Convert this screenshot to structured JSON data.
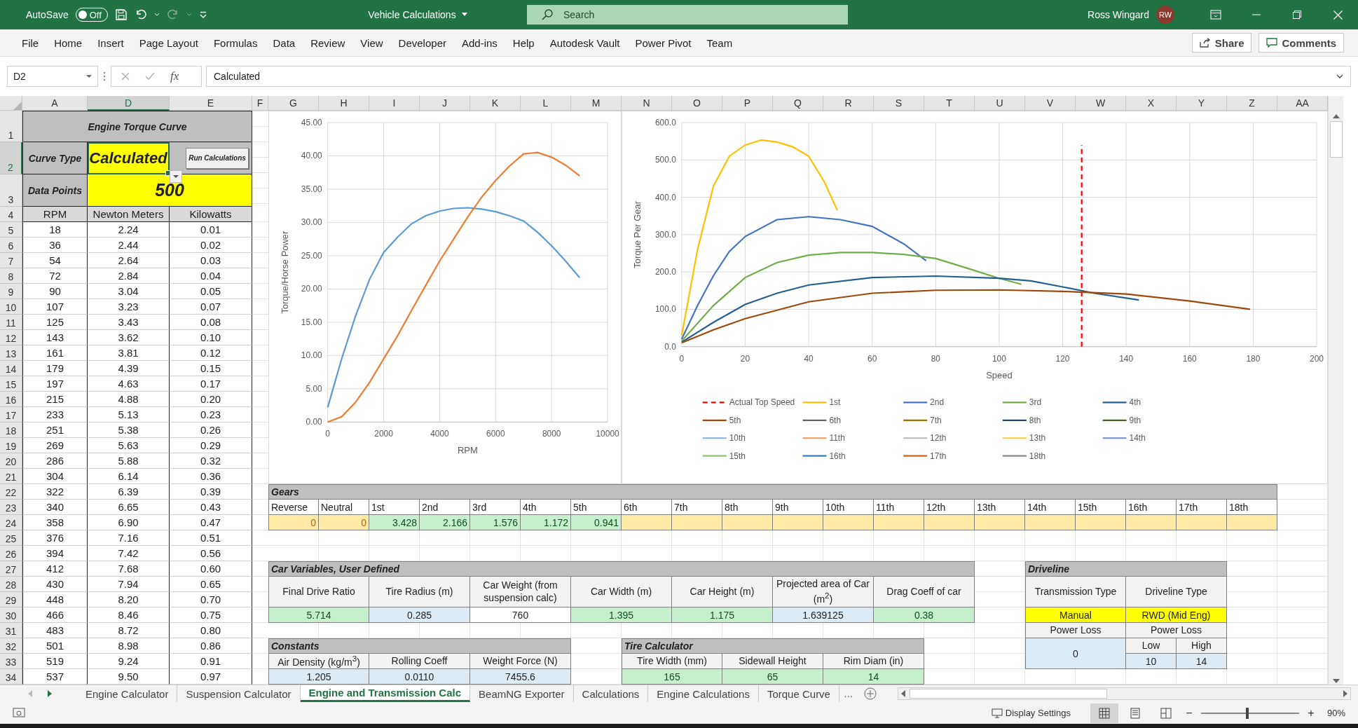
{
  "title_bar": {
    "autosave_label": "AutoSave",
    "autosave": {
      "on": false,
      "label": "Off"
    },
    "document_title": "Vehicle Calculations",
    "search_placeholder": "Search",
    "user_name": "Ross Wingard",
    "user_initials": "RW"
  },
  "ribbon_tabs": [
    "File",
    "Home",
    "Insert",
    "Page Layout",
    "Formulas",
    "Data",
    "Review",
    "View",
    "Developer",
    "Add-ins",
    "Help",
    "Autodesk Vault",
    "Power Pivot",
    "Team"
  ],
  "share_button": "Share",
  "comments_button": "Comments",
  "formula_bar": {
    "name_box": "D2",
    "fx": "fx",
    "value": "Calculated"
  },
  "column_headers": [
    {
      "label": "A",
      "selected": false
    },
    {
      "label": "D",
      "selected": true
    },
    {
      "label": "E",
      "selected": false
    },
    {
      "label": "F",
      "selected": false
    },
    {
      "label": "G",
      "selected": false
    },
    {
      "label": "H",
      "selected": false
    },
    {
      "label": "I",
      "selected": false
    },
    {
      "label": "J",
      "selected": false
    },
    {
      "label": "K",
      "selected": false
    },
    {
      "label": "L",
      "selected": false
    },
    {
      "label": "M",
      "selected": false
    },
    {
      "label": "N",
      "selected": false
    },
    {
      "label": "O",
      "selected": false
    },
    {
      "label": "P",
      "selected": false
    },
    {
      "label": "Q",
      "selected": false
    },
    {
      "label": "R",
      "selected": false
    },
    {
      "label": "S",
      "selected": false
    },
    {
      "label": "T",
      "selected": false
    },
    {
      "label": "U",
      "selected": false
    },
    {
      "label": "V",
      "selected": false
    },
    {
      "label": "W",
      "selected": false
    },
    {
      "label": "X",
      "selected": false
    },
    {
      "label": "Y",
      "selected": false
    },
    {
      "label": "Z",
      "selected": false
    },
    {
      "label": "AA",
      "selected": false
    }
  ],
  "row_headers": [
    {
      "label": "1",
      "selected": false
    },
    {
      "label": "2",
      "selected": true
    },
    {
      "label": "3",
      "selected": false
    },
    {
      "label": "4",
      "selected": false
    },
    {
      "label": "5",
      "selected": false
    },
    {
      "label": "6",
      "selected": false
    },
    {
      "label": "7",
      "selected": false
    },
    {
      "label": "8",
      "selected": false
    },
    {
      "label": "9",
      "selected": false
    },
    {
      "label": "10",
      "selected": false
    },
    {
      "label": "11",
      "selected": false
    },
    {
      "label": "12",
      "selected": false
    },
    {
      "label": "13",
      "selected": false
    },
    {
      "label": "14",
      "selected": false
    },
    {
      "label": "15",
      "selected": false
    },
    {
      "label": "16",
      "selected": false
    },
    {
      "label": "17",
      "selected": false
    },
    {
      "label": "18",
      "selected": false
    },
    {
      "label": "19",
      "selected": false
    },
    {
      "label": "20",
      "selected": false
    },
    {
      "label": "21",
      "selected": false
    },
    {
      "label": "22",
      "selected": false
    },
    {
      "label": "23",
      "selected": false
    },
    {
      "label": "24",
      "selected": false
    },
    {
      "label": "25",
      "selected": false
    },
    {
      "label": "26",
      "selected": false
    },
    {
      "label": "27",
      "selected": false
    },
    {
      "label": "28",
      "selected": false
    },
    {
      "label": "29",
      "selected": false
    },
    {
      "label": "30",
      "selected": false
    },
    {
      "label": "31",
      "selected": false
    },
    {
      "label": "32",
      "selected": false
    },
    {
      "label": "33",
      "selected": false
    },
    {
      "label": "34",
      "selected": false
    }
  ],
  "torque_table": {
    "title": "Engine Torque Curve",
    "curve_type_label": "Curve Type",
    "curve_type": "Calculated",
    "run_button": "Run Calculations",
    "data_points_label": "Data Points",
    "data_points": "500",
    "columns": [
      "RPM",
      "Newton Meters",
      "Kilowatts"
    ],
    "rows": [
      [
        "18",
        "2.24",
        "0.01"
      ],
      [
        "36",
        "2.44",
        "0.02"
      ],
      [
        "54",
        "2.64",
        "0.03"
      ],
      [
        "72",
        "2.84",
        "0.04"
      ],
      [
        "90",
        "3.04",
        "0.05"
      ],
      [
        "107",
        "3.23",
        "0.07"
      ],
      [
        "125",
        "3.43",
        "0.08"
      ],
      [
        "143",
        "3.62",
        "0.10"
      ],
      [
        "161",
        "3.81",
        "0.12"
      ],
      [
        "179",
        "4.39",
        "0.15"
      ],
      [
        "197",
        "4.63",
        "0.17"
      ],
      [
        "215",
        "4.88",
        "0.20"
      ],
      [
        "233",
        "5.13",
        "0.23"
      ],
      [
        "251",
        "5.38",
        "0.26"
      ],
      [
        "269",
        "5.63",
        "0.29"
      ],
      [
        "286",
        "5.88",
        "0.32"
      ],
      [
        "304",
        "6.14",
        "0.36"
      ],
      [
        "322",
        "6.39",
        "0.39"
      ],
      [
        "340",
        "6.65",
        "0.43"
      ],
      [
        "358",
        "6.90",
        "0.47"
      ],
      [
        "376",
        "7.16",
        "0.51"
      ],
      [
        "394",
        "7.42",
        "0.56"
      ],
      [
        "412",
        "7.68",
        "0.60"
      ],
      [
        "430",
        "7.94",
        "0.65"
      ],
      [
        "448",
        "8.20",
        "0.70"
      ],
      [
        "466",
        "8.46",
        "0.75"
      ],
      [
        "483",
        "8.72",
        "0.80"
      ],
      [
        "501",
        "8.98",
        "0.86"
      ],
      [
        "519",
        "9.24",
        "0.91"
      ],
      [
        "537",
        "9.50",
        "0.97"
      ]
    ]
  },
  "charts": [
    {
      "chart_data": {
        "type": "line",
        "xlabel": "RPM",
        "ylabel": "Torque/Horse Power",
        "x": [
          0,
          500,
          1000,
          1500,
          2000,
          2500,
          3000,
          3500,
          4000,
          4500,
          5000,
          5500,
          6000,
          6500,
          7000,
          7500,
          8000,
          8500,
          9000
        ],
        "xlim": [
          0,
          10000
        ],
        "ylim": [
          0,
          45
        ],
        "xticks": [
          0,
          2000,
          4000,
          6000,
          8000,
          10000
        ],
        "yticks": [
          {
            "value": 0,
            "label": "0.00"
          },
          {
            "value": 5,
            "label": "5.00"
          },
          {
            "value": 10,
            "label": "10.00"
          },
          {
            "value": 15,
            "label": "15.00"
          },
          {
            "value": 20,
            "label": "20.00"
          },
          {
            "value": 25,
            "label": "25.00"
          },
          {
            "value": 30,
            "label": "30.00"
          },
          {
            "value": 35,
            "label": "35.00"
          },
          {
            "value": 40,
            "label": "40.00"
          },
          {
            "value": 45,
            "label": "45.00"
          }
        ],
        "grid": true,
        "series": [
          {
            "color": "#5b9bd5",
            "values": [
              2.2,
              9.5,
              16,
              21.5,
              25.5,
              27.8,
              29.8,
              31,
              31.7,
              32.1,
              32.2,
              32,
              31.6,
              31,
              30.2,
              28.5,
              26.5,
              24.2,
              21.7
            ]
          },
          {
            "color": "#ed7d31",
            "values": [
              0,
              0.8,
              3,
              6,
              9.5,
              13,
              16.8,
              20.5,
              24.2,
              27.5,
              30.8,
              33.8,
              36.3,
              38.5,
              40.3,
              40.5,
              39.8,
              38.6,
              37
            ]
          }
        ]
      }
    },
    {
      "chart_data": {
        "type": "line",
        "xlabel": "Speed",
        "ylabel": "Torque Per Gear",
        "xlim": [
          0,
          200
        ],
        "ylim": [
          0,
          600
        ],
        "xticks": [
          0,
          20,
          40,
          60,
          80,
          100,
          120,
          140,
          160,
          180,
          200
        ],
        "yticks": [
          {
            "value": 0,
            "label": "0.0"
          },
          {
            "value": 100,
            "label": "100.0"
          },
          {
            "value": 200,
            "label": "200.0"
          },
          {
            "value": 300,
            "label": "300.0"
          },
          {
            "value": 400,
            "label": "400.0"
          },
          {
            "value": 500,
            "label": "500.0"
          },
          {
            "value": 600,
            "label": "600.0"
          }
        ],
        "grid": true,
        "legend": true,
        "series": [
          {
            "name": "Actual Top Speed",
            "color": "#ff0000",
            "line_style": "dashed",
            "x": [
              126,
              126
            ],
            "values": [
              0,
              540
            ]
          },
          {
            "name": "1st",
            "color": "#ffc000",
            "x": [
              0,
              5,
              10,
              15,
              20,
              25,
              30,
              35,
              40,
              45,
              49
            ],
            "values": [
              30,
              260,
              430,
              510,
              540,
              553,
              548,
              535,
              510,
              440,
              365
            ]
          },
          {
            "name": "2nd",
            "color": "#4472c4",
            "x": [
              0,
              5,
              10,
              15,
              20,
              30,
              40,
              50,
              60,
              70,
              77
            ],
            "values": [
              20,
              110,
              190,
              255,
              295,
              340,
              348,
              340,
              322,
              275,
              230
            ]
          },
          {
            "name": "3rd",
            "color": "#70ad47",
            "x": [
              0,
              10,
              20,
              30,
              40,
              50,
              60,
              70,
              80,
              90,
              100,
              107
            ],
            "values": [
              15,
              110,
              185,
              225,
              245,
              252,
              252,
              247,
              236,
              210,
              183,
              167
            ]
          },
          {
            "name": "4th",
            "color": "#255e91",
            "x": [
              0,
              10,
              20,
              30,
              40,
              60,
              80,
              100,
              110,
              120,
              130,
              144
            ],
            "values": [
              12,
              65,
              113,
              143,
              165,
              185,
              189,
              183,
              176,
              160,
              143,
              125
            ]
          },
          {
            "name": "5th",
            "color": "#9e480e",
            "x": [
              0,
              10,
              20,
              40,
              60,
              80,
              100,
              120,
              140,
              160,
              179
            ],
            "values": [
              10,
              45,
              75,
              120,
              143,
              151,
              152,
              148,
              141,
              122,
              100
            ]
          },
          {
            "name": "6th",
            "color": "#636363"
          },
          {
            "name": "7th",
            "color": "#997300"
          },
          {
            "name": "8th",
            "color": "#264478"
          },
          {
            "name": "9th",
            "color": "#43682b"
          },
          {
            "name": "10th",
            "color": "#7cafdd"
          },
          {
            "name": "11th",
            "color": "#f1975a"
          },
          {
            "name": "12th",
            "color": "#b7b7b7"
          },
          {
            "name": "13th",
            "color": "#ffcd33"
          },
          {
            "name": "14th",
            "color": "#698ed0"
          },
          {
            "name": "15th",
            "color": "#8cc168"
          },
          {
            "name": "16th",
            "color": "#327dc2"
          },
          {
            "name": "17th",
            "color": "#d26012"
          },
          {
            "name": "18th",
            "color": "#848484"
          }
        ]
      }
    }
  ],
  "gears": {
    "title": "Gears",
    "items": [
      {
        "label": "Reverse",
        "value": "0",
        "kind": "fixed"
      },
      {
        "label": "Neutral",
        "value": "0",
        "kind": "fixed"
      },
      {
        "label": "1st",
        "value": "3.428",
        "kind": "ratio"
      },
      {
        "label": "2nd",
        "value": "2.166",
        "kind": "ratio"
      },
      {
        "label": "3rd",
        "value": "1.576",
        "kind": "ratio"
      },
      {
        "label": "4th",
        "value": "1.172",
        "kind": "ratio"
      },
      {
        "label": "5th",
        "value": "0.941",
        "kind": "ratio"
      },
      {
        "label": "6th",
        "kind": "unset"
      },
      {
        "label": "7th",
        "kind": "unset"
      },
      {
        "label": "8th",
        "kind": "unset"
      },
      {
        "label": "9th",
        "kind": "unset"
      },
      {
        "label": "10th",
        "kind": "unset"
      },
      {
        "label": "11th",
        "kind": "unset"
      },
      {
        "label": "12th",
        "kind": "unset"
      },
      {
        "label": "13th",
        "kind": "unset"
      },
      {
        "label": "14th",
        "kind": "unset"
      },
      {
        "label": "15th",
        "kind": "unset"
      },
      {
        "label": "16th",
        "kind": "unset"
      },
      {
        "label": "17th",
        "kind": "unset"
      },
      {
        "label": "18th",
        "kind": "unset"
      }
    ]
  },
  "car_variables": {
    "title": "Car Variables, User Defined",
    "fields": [
      {
        "label": "Final Drive Ratio",
        "value": "5.714",
        "kind": "input"
      },
      {
        "label": "Tire Radius (m)",
        "value": "0.285",
        "kind": "computed"
      },
      {
        "label": "Car Weight (from suspension calc)",
        "value": "760",
        "kind": "plain"
      },
      {
        "label": "Car Width (m)",
        "value": "1.395",
        "kind": "input"
      },
      {
        "label": "Car Height (m)",
        "value": "1.175",
        "kind": "input"
      },
      {
        "label": "Projected area of Car (m$^{2}$)",
        "value": "1.639125",
        "kind": "computed"
      },
      {
        "label": "Drag Coeff of car",
        "value": "0.38",
        "kind": "input"
      }
    ]
  },
  "driveline": {
    "title": "Driveline",
    "transmission_label": "Transmission Type",
    "driveline_label": "Driveline Type",
    "transmission": "Manual",
    "driveline": "RWD (Mid Eng)",
    "power_loss_labels": [
      "Power Loss",
      "Power Loss"
    ],
    "power_loss": "0",
    "low_label": "Low",
    "high_label": "High",
    "low": "10",
    "high": "14"
  },
  "constants": {
    "title": "Constants",
    "fields": [
      {
        "label": "Air Density (kg/m$^{3}$)",
        "value": "1.205",
        "kind": "computed"
      },
      {
        "label": "Rolling Coeff",
        "value": "0.0110",
        "kind": "computed"
      },
      {
        "label": "Weight Force (N)",
        "value": "7455.6",
        "kind": "computed"
      }
    ]
  },
  "tire_calculator": {
    "title": "Tire Calculator",
    "fields": [
      {
        "label": "Tire Width (mm)",
        "value": "165",
        "kind": "input"
      },
      {
        "label": "Sidewall Height",
        "value": "65",
        "kind": "input"
      },
      {
        "label": "Rim Diam (in)",
        "value": "14",
        "kind": "input"
      }
    ]
  },
  "sheet_tabs": [
    {
      "label": "Engine Calculator",
      "selected": false
    },
    {
      "label": "Suspension Calculator",
      "selected": false
    },
    {
      "label": "Engine and Transmission Calc",
      "selected": true
    },
    {
      "label": "BeamNG Exporter",
      "selected": false
    },
    {
      "label": "Calculations",
      "selected": false
    },
    {
      "label": "Engine Calculations",
      "selected": false
    },
    {
      "label": "Torque Curve",
      "selected": false
    }
  ],
  "more_tabs": "…",
  "status_bar": {
    "display_settings": "Display Settings",
    "views": [
      {
        "kind": "normal",
        "selected": true
      },
      {
        "kind": "page-layout",
        "selected": false
      },
      {
        "kind": "page-break",
        "selected": false
      }
    ],
    "zoom_out": "−",
    "zoom": {
      "level": 0.47
    },
    "zoom_in": "+",
    "zoom_label": "90%"
  }
}
